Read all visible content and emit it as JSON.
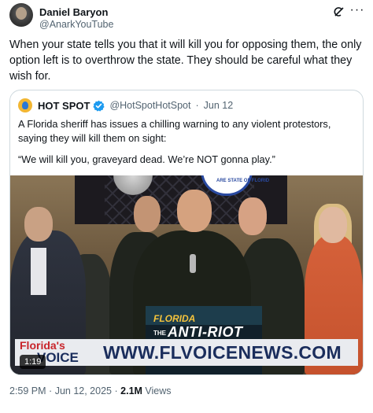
{
  "author": {
    "name": "Daniel Baryon",
    "handle": "@AnarkYouTube",
    "icons": {
      "grok": "grok-icon",
      "more": "more-horizontal-icon"
    },
    "more_label": "···"
  },
  "tweet": {
    "text": "When your state tells you that it will kill you for opposing them, the only option left is to overthrow the state. They should be careful what they wish for."
  },
  "quoted": {
    "name": "HOT SPOT",
    "verified": true,
    "handle": "@HotSpotHotSpot",
    "date_separator": "·",
    "date": "Jun 12",
    "text": "A Florida sheriff has issues a chilling warning to any violent protestors, saying they will kill them on sight:",
    "quote_line": "“We will kill you, graveyard dead. We’re NOT gonna play.”",
    "video": {
      "duration": "1:19",
      "podium_top": "FLORIDA",
      "podium_the": "THE",
      "podium_main": "ANTI-RIOT",
      "banner_logo_top": "Florida's",
      "banner_logo_bottom": "VOICE",
      "banner_url": "WWW.FLVOICENEWS.COM",
      "seal_text": "ARE STATE OF FLORID"
    }
  },
  "footer": {
    "time": "2:59 PM",
    "separator": "·",
    "date": "Jun 12, 2025",
    "separator2": "·",
    "views_count": "2.1M",
    "views_label": "Views"
  },
  "colors": {
    "text_primary": "#0f1419",
    "text_secondary": "#536471",
    "border": "#cfd9de",
    "verified": "#1d9bf0",
    "banner_red": "#c8242a",
    "banner_navy": "#1a2d5c",
    "podium_gold": "#f4c33c"
  }
}
